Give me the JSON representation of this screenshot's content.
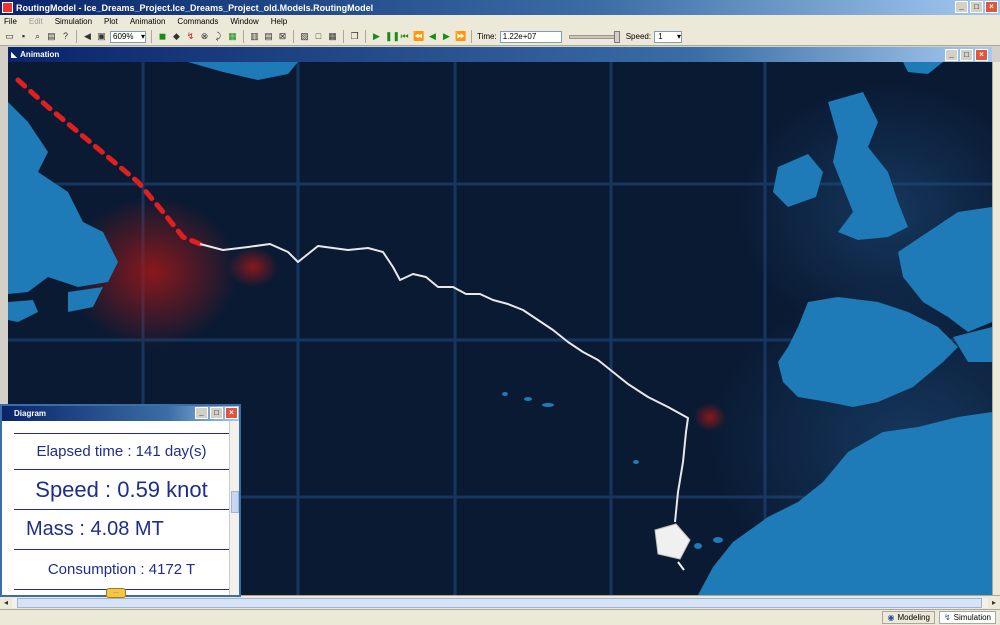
{
  "window": {
    "title": "RoutingModel - Ice_Dreams_Project.Ice_Dreams_Project_old.Models.RoutingModel"
  },
  "menu": [
    "File",
    "Edit",
    "Simulation",
    "Plot",
    "Animation",
    "Commands",
    "Window",
    "Help"
  ],
  "toolbar": {
    "zoom_value": "609%",
    "time_label": "Time:",
    "time_value": "1.22e+07",
    "speed_label": "Speed:",
    "speed_value": "1"
  },
  "animation_window": {
    "title": "Animation"
  },
  "diagram_window": {
    "title": "Diagram",
    "elapsed_time": "Elapsed time : 141 day(s)",
    "speed": "Speed : 0.59 knot",
    "mass": "Mass : 4.08 MT",
    "consumption": "Consumption : 4172 T"
  },
  "status": {
    "modeling_label": "Modeling",
    "simulation_label": "Simulation"
  },
  "colors": {
    "ocean": "#0a1a33",
    "land": "#1f7ab8",
    "grid": "#16355f",
    "route_dashed": "#e02020",
    "route_solid": "#f0f0f0",
    "heat": "#a01818",
    "diagram_text": "#1f2d8c"
  }
}
